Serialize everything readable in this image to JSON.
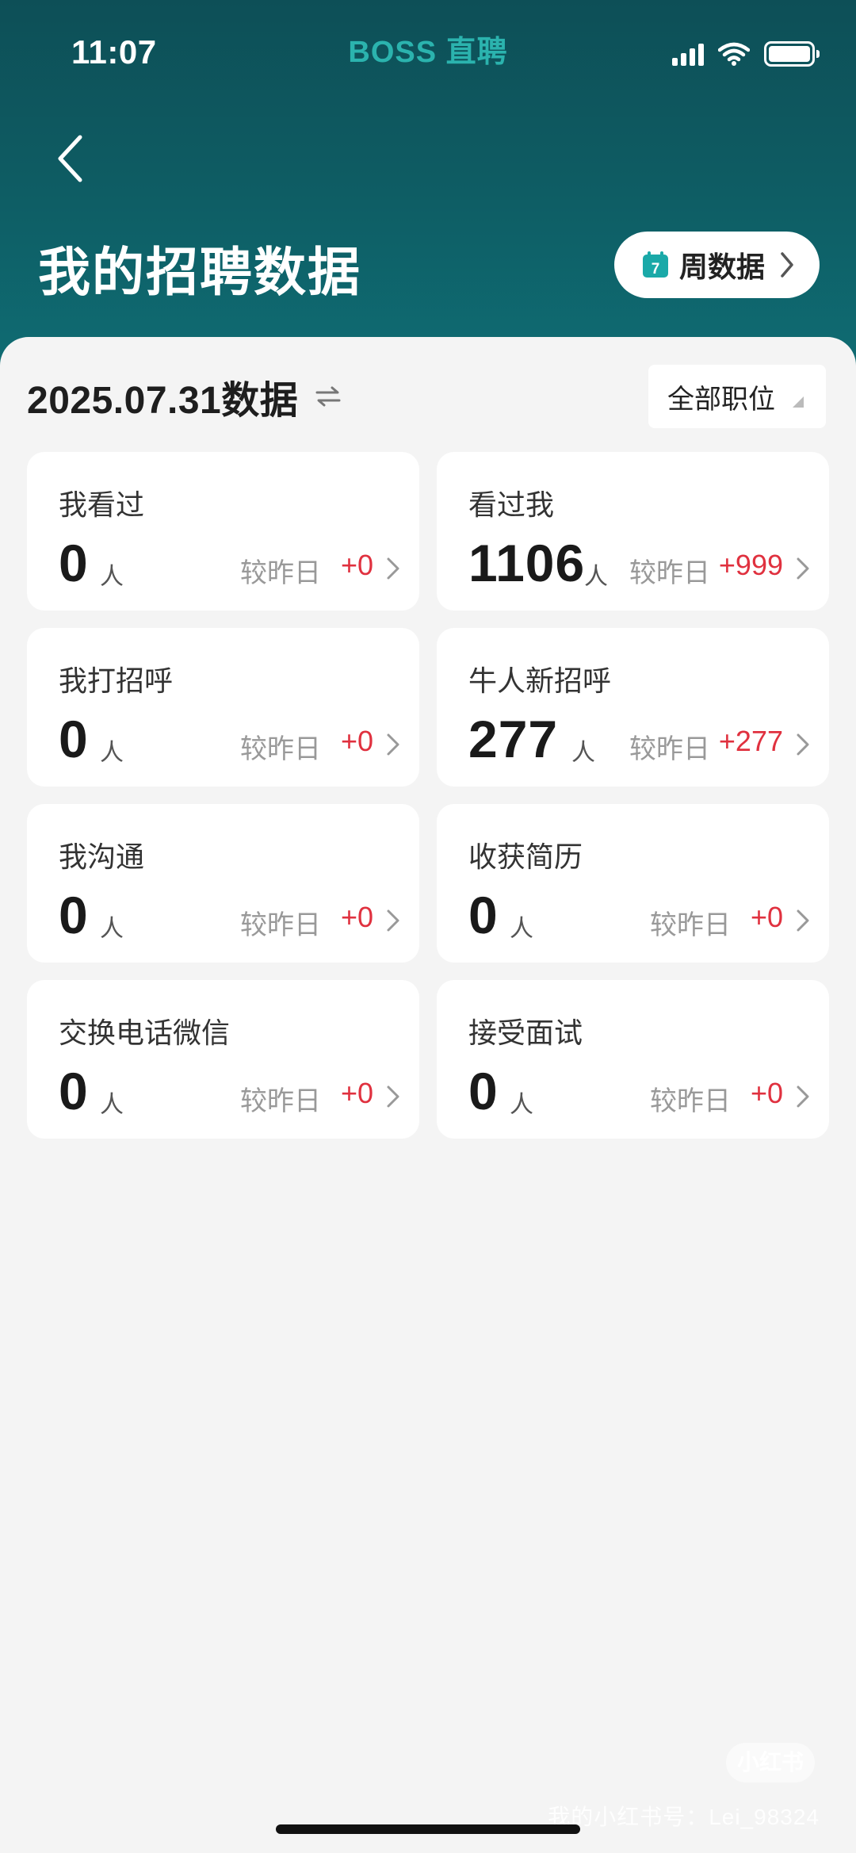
{
  "status_bar": {
    "time": "11:07",
    "brand": "BOSS 直聘"
  },
  "header": {
    "title": "我的招聘数据",
    "week_button": {
      "icon_number": "7",
      "label": "周数据"
    }
  },
  "toolbar": {
    "date_label": "2025.07.31数据",
    "filter_label": "全部职位"
  },
  "compare_label": "较昨日",
  "unit": "人",
  "cards": [
    {
      "title": "我看过",
      "value": "0",
      "delta": "+0"
    },
    {
      "title": "看过我",
      "value": "1106",
      "delta": "+999"
    },
    {
      "title": "我打招呼",
      "value": "0",
      "delta": "+0"
    },
    {
      "title": "牛人新招呼",
      "value": "277",
      "delta": "+277"
    },
    {
      "title": "我沟通",
      "value": "0",
      "delta": "+0"
    },
    {
      "title": "收获简历",
      "value": "0",
      "delta": "+0"
    },
    {
      "title": "交换电话微信",
      "value": "0",
      "delta": "+0"
    },
    {
      "title": "接受面试",
      "value": "0",
      "delta": "+0"
    }
  ],
  "watermark": {
    "logo": "小红书",
    "text": "我的小红书号：Lei_98324"
  },
  "colors": {
    "header": "#0e5b62",
    "brand": "#2bb3ae",
    "delta": "#e0313f",
    "calendar": "#1aa9a8"
  }
}
